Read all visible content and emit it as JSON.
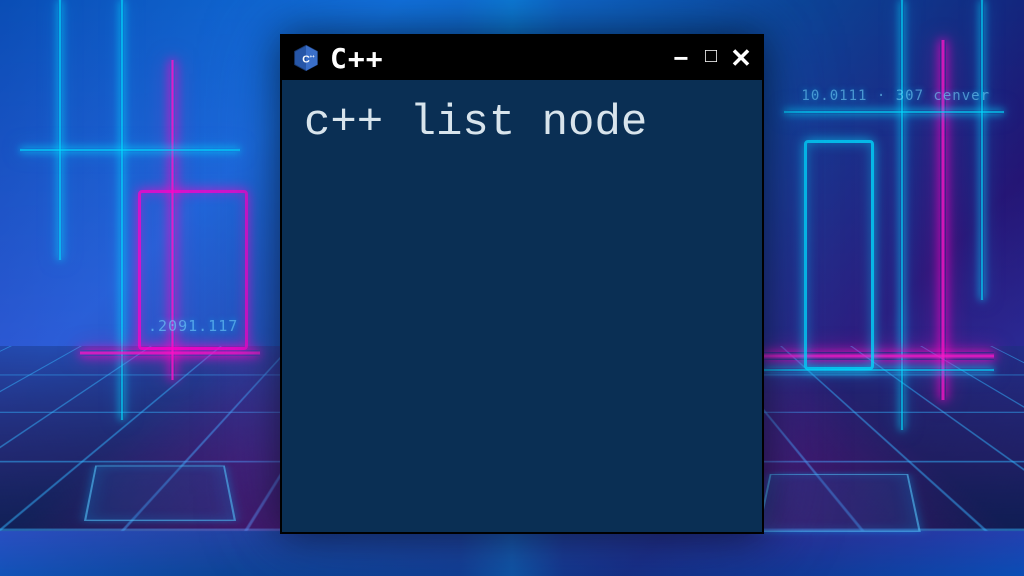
{
  "window": {
    "title": "C++",
    "icon_name": "cpp-hexagon-icon",
    "controls": {
      "minimize_glyph": "−",
      "maximize_glyph": "□",
      "close_glyph": "✕"
    }
  },
  "terminal": {
    "content": "c++ list node"
  },
  "background": {
    "deco_text_left": ".2091.117",
    "deco_text_right": "10.0111 · 307  cenver"
  },
  "colors": {
    "terminal_bg": "#0a2f54",
    "titlebar_bg": "#000000",
    "neon_cyan": "#00dcff",
    "neon_magenta": "#ff14c8"
  }
}
